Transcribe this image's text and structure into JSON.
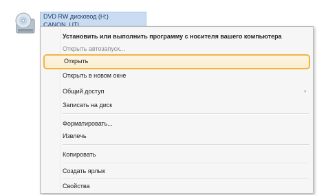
{
  "drive": {
    "name": "DVD RW дисковод (H:)",
    "label": "CANON_UTL",
    "icon": "cd-drive-icon"
  },
  "menu": {
    "items": [
      {
        "label": "Установить или выполнить программу с носителя вашего компьютера",
        "bold": true
      },
      {
        "label": "Открыть автозапуск...",
        "faded": true
      },
      {
        "label": "Открыть",
        "highlighted": true
      },
      {
        "label": "Открыть в новом окне"
      },
      {
        "label": "Общий доступ",
        "submenu": "›"
      },
      {
        "label": "Записать на диск"
      },
      {
        "label": "Форматировать..."
      },
      {
        "label": "Извлечь"
      },
      {
        "label": "Копировать"
      },
      {
        "label": "Создать ярлык"
      },
      {
        "label": "Свойства"
      }
    ]
  },
  "colors": {
    "highlight_border": "#f3b343",
    "selection": "#c9dcf2"
  }
}
